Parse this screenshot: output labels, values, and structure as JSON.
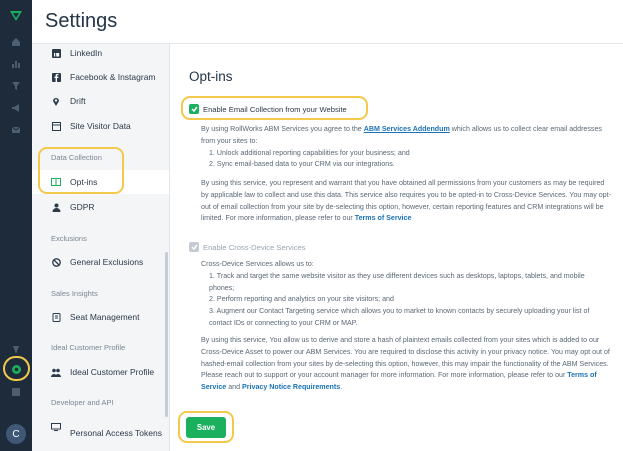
{
  "header": {
    "title": "Settings"
  },
  "rail": {
    "avatar_initial": "C",
    "icons": [
      "logo-icon",
      "home-icon",
      "chart-icon",
      "filter-icon",
      "megaphone-icon",
      "mail-icon",
      "shield-icon",
      "gear-icon",
      "book-icon"
    ]
  },
  "sidebar": {
    "items": [
      {
        "label": "LinkedIn",
        "icon": "linkedin-icon"
      },
      {
        "label": "Facebook & Instagram",
        "icon": "facebook-icon"
      },
      {
        "label": "Drift",
        "icon": "drift-icon"
      },
      {
        "label": "Site Visitor Data",
        "icon": "site-data-icon"
      },
      {
        "label": "Opt-ins",
        "icon": "book-icon"
      },
      {
        "label": "GDPR",
        "icon": "user-icon"
      },
      {
        "label": "General Exclusions",
        "icon": "block-icon"
      },
      {
        "label": "Seat Management",
        "icon": "seat-icon"
      },
      {
        "label": "Ideal Customer Profile",
        "icon": "profile-icon"
      },
      {
        "label": "Personal Access Tokens",
        "icon": "token-icon"
      }
    ],
    "sections": [
      "Data Collection",
      "Exclusions",
      "Sales Insights",
      "Ideal Customer Profile",
      "Developer and API"
    ]
  },
  "main": {
    "title": "Opt-ins",
    "email": {
      "label": "Enable Email Collection from your Website",
      "checked": true,
      "p1_pre": "By using RollWorks ABM Services you agree to the ",
      "p1_link": "ABM Services Addendum",
      "p1_post": " which allows us to collect clear email addresses from your sites to:",
      "list": [
        "1. Unlock additional reporting capabilities for your business; and",
        "2. Sync email-based data to your CRM via our integrations."
      ],
      "p2": "By using this service, you represent and warrant that you have obtained all permissions from your customers as may be required by applicable law to collect and use this data. This service also requires you to be opted-in to Cross-Device Services. You may opt-out of email collection from your site by de-selecting this option, however, certain reporting features and CRM integrations will be limited. For more information, please refer to our ",
      "p2_link": "Terms of Service"
    },
    "cross": {
      "label": "Enable Cross-Device Services",
      "checked": true,
      "intro": "Cross-Device Services allows us to:",
      "list": [
        "1. Track and target the same website visitor as they use different devices such as desktops, laptops, tablets, and mobile phones;",
        "2. Perform reporting and analytics on your site visitors; and",
        "3. Augment our Contact Targeting service which allows you to market to known contacts by securely uploading your list of contact IDs or connecting to your CRM or MAP."
      ],
      "p": "By using this service, You allow us to derive and store a hash of plaintext emails collected from your sites which is added to our Cross-Device Asset to power our ABM Services. You are required to disclose this activity in your privacy notice. You may opt out of hashed-email collection from your sites by de-selecting this option, however, this may impair the functionality of the ABM Services. Please reach out to support or your account manager for more information. For more information, please refer to our ",
      "link1": "Terms of Service",
      "and": " and ",
      "link2": "Privacy Notice Requirements",
      "end": "."
    },
    "save_label": "Save"
  },
  "colors": {
    "rail": "#1d2b3a",
    "accent": "#1ab05d",
    "highlight": "#f2c94c",
    "link": "#1a73b8"
  }
}
